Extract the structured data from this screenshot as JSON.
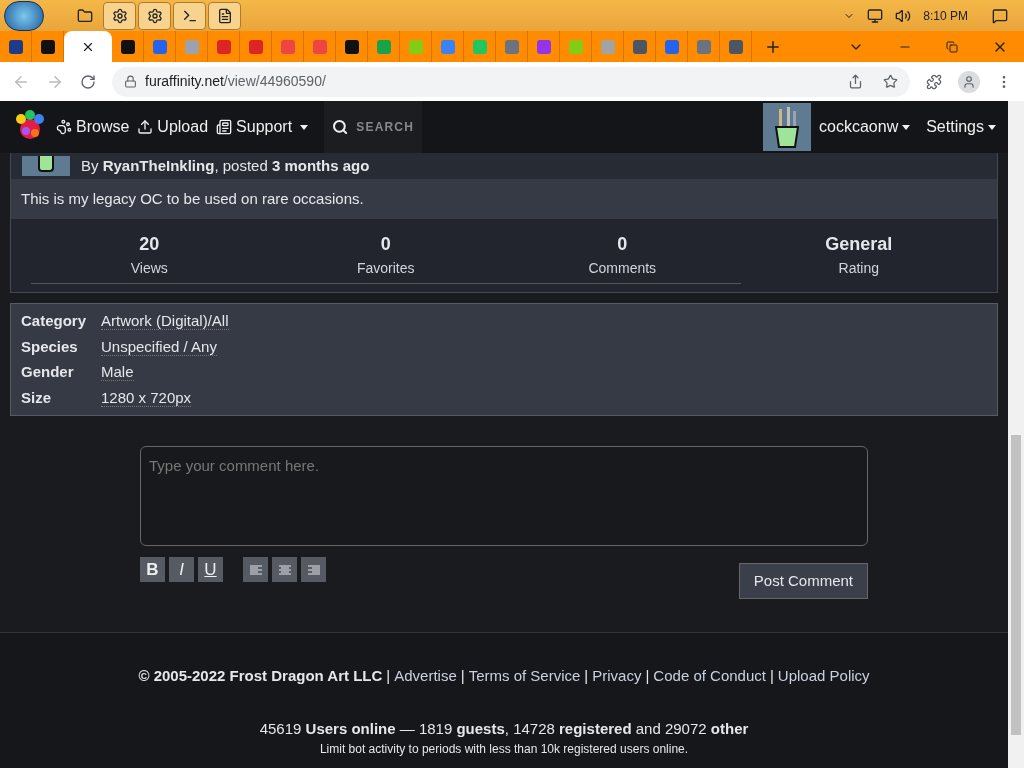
{
  "taskbar": {
    "apps": [
      {
        "selected": false
      },
      {
        "selected": true
      },
      {
        "selected": true
      },
      {
        "selected": true
      },
      {
        "selected": true
      }
    ],
    "clock": "8:10 PM"
  },
  "browser": {
    "tabs": [
      {
        "selected": false,
        "color": "#1e3a8a"
      },
      {
        "selected": false,
        "color": "#111111"
      },
      {
        "selected": true
      },
      {
        "selected": false,
        "color": "#111111"
      },
      {
        "selected": false,
        "color": "#2563eb"
      },
      {
        "selected": false,
        "color": "#9ca3af"
      },
      {
        "selected": false,
        "color": "#dc2626"
      },
      {
        "selected": false,
        "color": "#dc2626"
      },
      {
        "selected": false,
        "color": "#ef4444"
      },
      {
        "selected": false,
        "color": "#ef4444"
      },
      {
        "selected": false,
        "color": "#111111"
      },
      {
        "selected": false,
        "color": "#16a34a"
      },
      {
        "selected": false,
        "color": "#84cc16"
      },
      {
        "selected": false,
        "color": "#3b82f6"
      },
      {
        "selected": false,
        "color": "#22c55e"
      },
      {
        "selected": false,
        "color": "#6b7280"
      },
      {
        "selected": false,
        "color": "#9333ea"
      },
      {
        "selected": false,
        "color": "#84cc16"
      },
      {
        "selected": false,
        "color": "#a3a3a3"
      },
      {
        "selected": false,
        "color": "#4b5563"
      },
      {
        "selected": false,
        "color": "#2563eb"
      },
      {
        "selected": false,
        "color": "#6b7280"
      },
      {
        "selected": false,
        "color": "#4b5563"
      }
    ],
    "url_host": "furaffinity.net",
    "url_path": "/view/44960590/"
  },
  "nav": {
    "items": [
      {
        "label": "Browse",
        "kind": "paw",
        "dropdown": false
      },
      {
        "label": "Upload",
        "kind": "upload",
        "dropdown": false
      },
      {
        "label": "Support",
        "kind": "support",
        "dropdown": true
      }
    ],
    "search_placeholder": "SEARCH",
    "user": "cockcaonw",
    "settings": "Settings"
  },
  "submission": {
    "byline": "By **RyanTheInkling**, posted **3 months ago**",
    "description": "This is my legacy OC to be used on rare occasions.",
    "stats": [
      {
        "value": "20",
        "label": "Views"
      },
      {
        "value": "0",
        "label": "Favorites"
      },
      {
        "value": "0",
        "label": "Comments"
      },
      {
        "value": "General",
        "label": "Rating"
      }
    ],
    "info": [
      {
        "key": "Category",
        "value": "Artwork (Digital)/All"
      },
      {
        "key": "Species",
        "value": "Unspecified / Any"
      },
      {
        "key": "Gender",
        "value": "Male"
      },
      {
        "key": "Size",
        "value": "1280 x 720px"
      }
    ]
  },
  "comment": {
    "placeholder": "Type your comment here.",
    "format_buttons": [
      {
        "kind": "bold",
        "label": "B"
      },
      {
        "kind": "italic",
        "label": "I"
      },
      {
        "kind": "underline",
        "label": "U"
      },
      {
        "kind": "left"
      },
      {
        "kind": "center"
      },
      {
        "kind": "right"
      }
    ],
    "submit": "Post Comment"
  },
  "footer": {
    "copyright": "© 2005-2022 Frost Dragon Art LLC",
    "separator": "|",
    "links": [
      "Advertise",
      "Terms of Service",
      "Privacy",
      "Code of Conduct",
      "Upload Policy"
    ],
    "online": "45619 **Users online** — 1819 **guests**, 14728 **registered** and 29072 **other**",
    "note": "Limit bot activity to periods with less than 10k registered users online."
  }
}
